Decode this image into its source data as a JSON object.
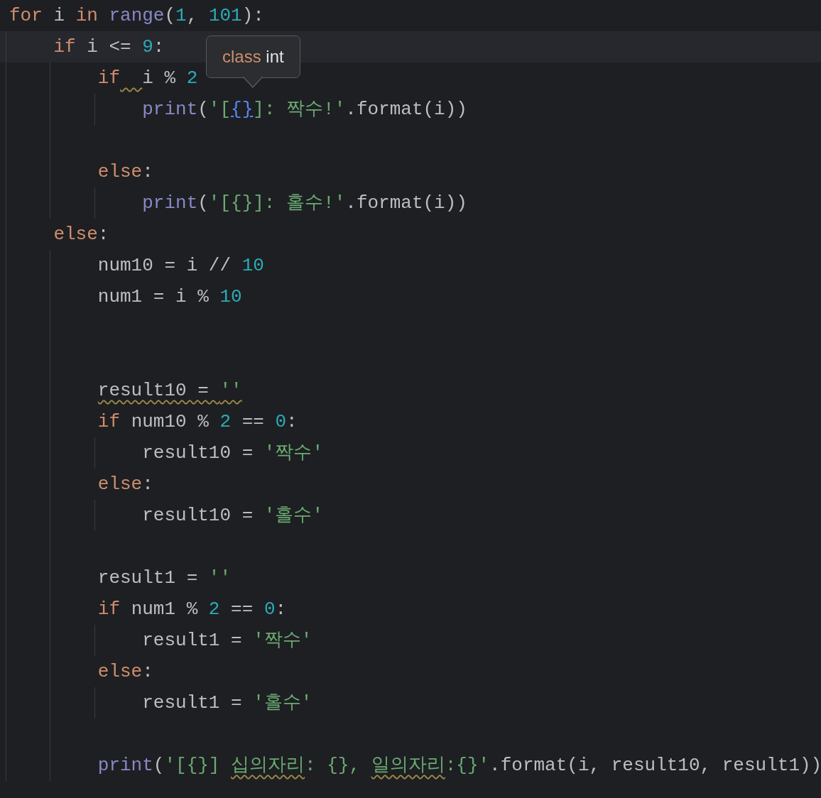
{
  "editor": {
    "lines": [
      {
        "current": false,
        "tokens": [
          {
            "kind": "kw",
            "text": "for"
          },
          {
            "kind": "plain",
            "text": " i "
          },
          {
            "kind": "kw",
            "text": "in"
          },
          {
            "kind": "fn",
            "text": " range"
          },
          {
            "kind": "plain",
            "text": "("
          },
          {
            "kind": "num",
            "text": "1"
          },
          {
            "kind": "plain",
            "text": ", "
          },
          {
            "kind": "num",
            "text": "101"
          },
          {
            "kind": "plain",
            "text": "):"
          }
        ],
        "children": [
          {
            "current": true,
            "tokens": [
              {
                "kind": "kw",
                "text": "if"
              },
              {
                "kind": "plain",
                "text": " i <= "
              },
              {
                "kind": "num",
                "text": "9"
              },
              {
                "kind": "plain",
                "text": ":"
              }
            ],
            "children": [
              {
                "current": false,
                "gap_warning": true,
                "tokens": [
                  {
                    "kind": "kw",
                    "text": "if"
                  },
                  {
                    "kind": "plain",
                    "text": "i % "
                  },
                  {
                    "kind": "num",
                    "text": "2"
                  }
                ],
                "children": [
                  {
                    "current": false,
                    "tokens": [
                      {
                        "kind": "fn",
                        "text": "print"
                      },
                      {
                        "kind": "plain",
                        "text": "("
                      },
                      {
                        "kind": "str",
                        "text": "'["
                      },
                      {
                        "kind": "ref",
                        "text": "{}"
                      },
                      {
                        "kind": "str",
                        "text": "]: 짝수!'"
                      },
                      {
                        "kind": "plain",
                        "text": ".format(i))"
                      }
                    ]
                  }
                ]
              },
              {
                "blank": true
              },
              {
                "current": false,
                "tokens": [
                  {
                    "kind": "kw",
                    "text": "else"
                  },
                  {
                    "kind": "plain",
                    "text": ":"
                  }
                ],
                "children": [
                  {
                    "current": false,
                    "tokens": [
                      {
                        "kind": "fn",
                        "text": "print"
                      },
                      {
                        "kind": "plain",
                        "text": "("
                      },
                      {
                        "kind": "str",
                        "text": "'[{}]: 홀수!'"
                      },
                      {
                        "kind": "plain",
                        "text": ".format(i))"
                      }
                    ]
                  }
                ]
              }
            ]
          },
          {
            "current": false,
            "tokens": [
              {
                "kind": "kw",
                "text": "else"
              },
              {
                "kind": "plain",
                "text": ":"
              }
            ],
            "children": [
              {
                "current": false,
                "tokens": [
                  {
                    "kind": "plain",
                    "text": "num10 = i // "
                  },
                  {
                    "kind": "num",
                    "text": "10"
                  }
                ]
              },
              {
                "current": false,
                "tokens": [
                  {
                    "kind": "plain",
                    "text": "num1 = i % "
                  },
                  {
                    "kind": "num",
                    "text": "10"
                  }
                ]
              },
              {
                "blank": true
              },
              {
                "blank": true
              },
              {
                "current": false,
                "tokens": [
                  {
                    "kind": "plain",
                    "text": "result10 = ",
                    "squiggly": true
                  },
                  {
                    "kind": "str",
                    "text": "''",
                    "squiggly": true
                  }
                ]
              },
              {
                "current": false,
                "tokens": [
                  {
                    "kind": "kw",
                    "text": "if"
                  },
                  {
                    "kind": "plain",
                    "text": " num10 % "
                  },
                  {
                    "kind": "num",
                    "text": "2"
                  },
                  {
                    "kind": "plain",
                    "text": " == "
                  },
                  {
                    "kind": "num",
                    "text": "0"
                  },
                  {
                    "kind": "plain",
                    "text": ":"
                  }
                ],
                "children": [
                  {
                    "current": false,
                    "tokens": [
                      {
                        "kind": "plain",
                        "text": "result10 = "
                      },
                      {
                        "kind": "str",
                        "text": "'짝수'"
                      }
                    ]
                  }
                ]
              },
              {
                "current": false,
                "tokens": [
                  {
                    "kind": "kw",
                    "text": "else"
                  },
                  {
                    "kind": "plain",
                    "text": ":"
                  }
                ],
                "children": [
                  {
                    "current": false,
                    "tokens": [
                      {
                        "kind": "plain",
                        "text": "result10 = "
                      },
                      {
                        "kind": "str",
                        "text": "'홀수'"
                      }
                    ]
                  }
                ]
              },
              {
                "blank": true
              },
              {
                "current": false,
                "tokens": [
                  {
                    "kind": "plain",
                    "text": "result1 = "
                  },
                  {
                    "kind": "str",
                    "text": "''"
                  }
                ]
              },
              {
                "current": false,
                "tokens": [
                  {
                    "kind": "kw",
                    "text": "if"
                  },
                  {
                    "kind": "plain",
                    "text": " num1 % "
                  },
                  {
                    "kind": "num",
                    "text": "2"
                  },
                  {
                    "kind": "plain",
                    "text": " == "
                  },
                  {
                    "kind": "num",
                    "text": "0"
                  },
                  {
                    "kind": "plain",
                    "text": ":"
                  }
                ],
                "children": [
                  {
                    "current": false,
                    "tokens": [
                      {
                        "kind": "plain",
                        "text": "result1 = "
                      },
                      {
                        "kind": "str",
                        "text": "'짝수'"
                      }
                    ]
                  }
                ]
              },
              {
                "current": false,
                "tokens": [
                  {
                    "kind": "kw",
                    "text": "else"
                  },
                  {
                    "kind": "plain",
                    "text": ":"
                  }
                ],
                "children": [
                  {
                    "current": false,
                    "tokens": [
                      {
                        "kind": "plain",
                        "text": "result1 = "
                      },
                      {
                        "kind": "str",
                        "text": "'홀수'"
                      }
                    ]
                  }
                ]
              },
              {
                "blank": true
              },
              {
                "current": false,
                "tokens": [
                  {
                    "kind": "fn",
                    "text": "print"
                  },
                  {
                    "kind": "plain",
                    "text": "("
                  },
                  {
                    "kind": "str",
                    "text": "'[{}] "
                  },
                  {
                    "kind": "str",
                    "text": "십의자리",
                    "squiggly": true
                  },
                  {
                    "kind": "str",
                    "text": ": {}, "
                  },
                  {
                    "kind": "str",
                    "text": "일의자리",
                    "squiggly": true
                  },
                  {
                    "kind": "str",
                    "text": ":{}'"
                  },
                  {
                    "kind": "plain",
                    "text": ".format(i, result10, result1))"
                  }
                ]
              }
            ]
          }
        ]
      }
    ],
    "tooltip": {
      "keyword": "class",
      "type": "int"
    }
  }
}
